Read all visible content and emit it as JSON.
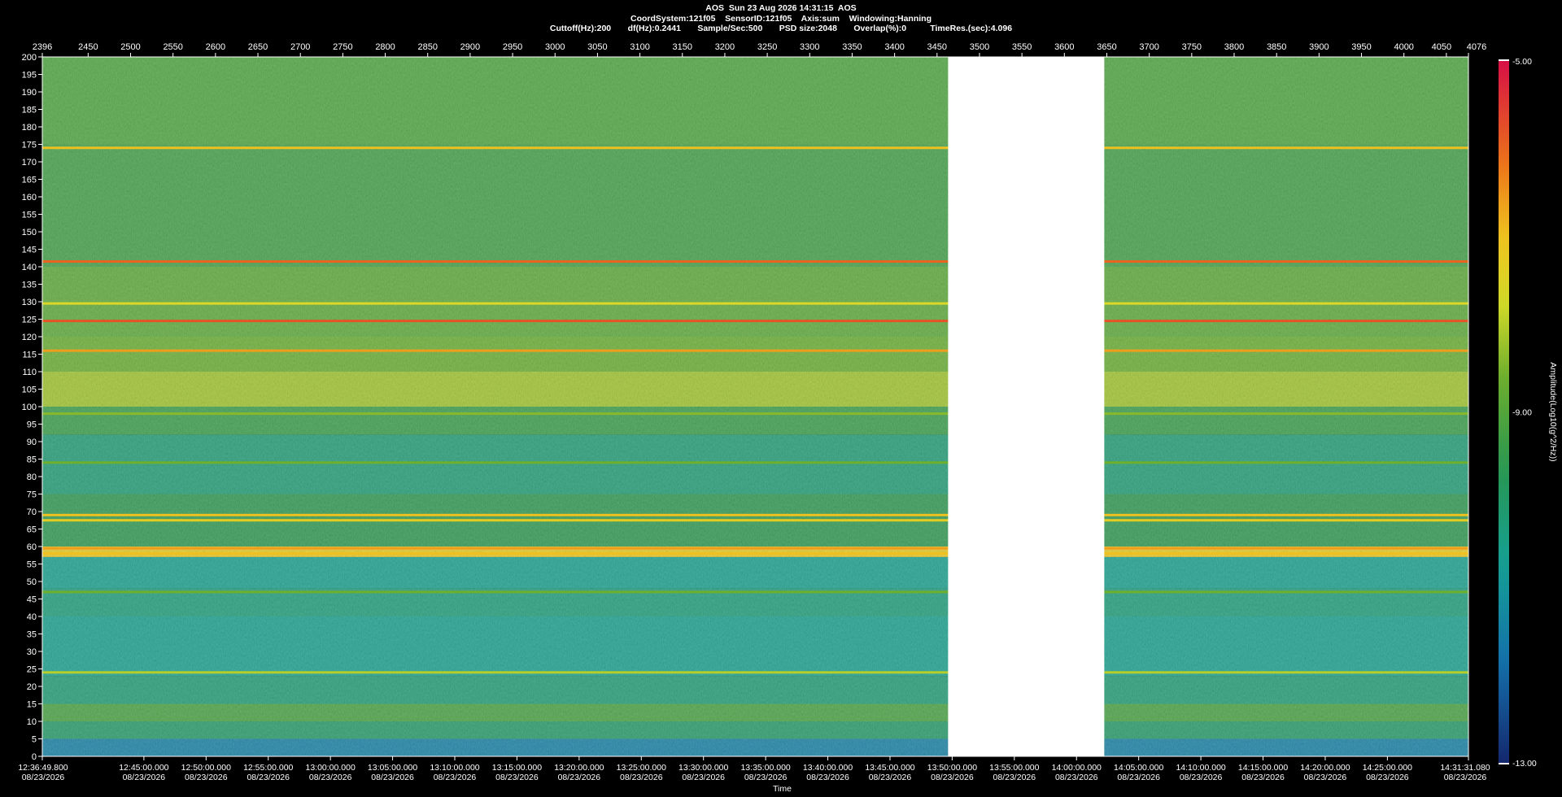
{
  "header": {
    "line1": "AOS  Sun 23 Aug 2026 14:31:15  AOS",
    "line2": "CoordSystem:121f05    SensorID:121f05    Axis:sum    Windowing:Hanning",
    "line3": "Cuttoff(Hz):200       df(Hz):0.2441       Sample/Sec:500       PSD size:2048       Overlap(%):0          TimeRes.(sec):4.096"
  },
  "chart_data": {
    "type": "heatmap",
    "title": "AOS  Sun 23 Aug 2026 14:31:15  AOS",
    "xlabel": "Time",
    "ylabel": "",
    "colorbar_label": "Amplitude(Log10(g^2/Hz))",
    "colorbar_range": [
      -13.0,
      -5.0
    ],
    "colorbar_ticks": [
      "-5.00",
      "-9.00",
      "-13.00"
    ],
    "ylim": [
      0,
      200
    ],
    "y_ticks": [
      200,
      195,
      190,
      185,
      180,
      175,
      170,
      165,
      160,
      155,
      150,
      145,
      140,
      135,
      130,
      125,
      120,
      115,
      110,
      105,
      100,
      95,
      90,
      85,
      80,
      75,
      70,
      65,
      60,
      55,
      50,
      45,
      40,
      35,
      30,
      25,
      20,
      15,
      10,
      5,
      0
    ],
    "top_axis_range": [
      2396,
      4076
    ],
    "top_axis_ticks": [
      2396,
      2450,
      2500,
      2550,
      2600,
      2650,
      2700,
      2750,
      2800,
      2850,
      2900,
      2950,
      3000,
      3050,
      3100,
      3150,
      3200,
      3250,
      3300,
      3350,
      3400,
      3450,
      3500,
      3550,
      3600,
      3650,
      3700,
      3750,
      3800,
      3850,
      3900,
      3950,
      4000,
      4050,
      4076
    ],
    "time_axis": {
      "start": "12:36:49.800",
      "end": "14:31:31.080",
      "ticks": [
        {
          "time": "12:36:49.800",
          "date": "08/23/2026"
        },
        {
          "time": "12:45:00.000",
          "date": "08/23/2026"
        },
        {
          "time": "12:50:00.000",
          "date": "08/23/2026"
        },
        {
          "time": "12:55:00.000",
          "date": "08/23/2026"
        },
        {
          "time": "13:00:00.000",
          "date": "08/23/2026"
        },
        {
          "time": "13:05:00.000",
          "date": "08/23/2026"
        },
        {
          "time": "13:10:00.000",
          "date": "08/23/2026"
        },
        {
          "time": "13:15:00.000",
          "date": "08/23/2026"
        },
        {
          "time": "13:20:00.000",
          "date": "08/23/2026"
        },
        {
          "time": "13:25:00.000",
          "date": "08/23/2026"
        },
        {
          "time": "13:30:00.000",
          "date": "08/23/2026"
        },
        {
          "time": "13:35:00.000",
          "date": "08/23/2026"
        },
        {
          "time": "13:40:00.000",
          "date": "08/23/2026"
        },
        {
          "time": "13:45:00.000",
          "date": "08/23/2026"
        },
        {
          "time": "13:50:00.000",
          "date": "08/23/2026"
        },
        {
          "time": "13:55:00.000",
          "date": "08/23/2026"
        },
        {
          "time": "14:00:00.000",
          "date": "08/23/2026"
        },
        {
          "time": "14:05:00.000",
          "date": "08/23/2026"
        },
        {
          "time": "14:10:00.000",
          "date": "08/23/2026"
        },
        {
          "time": "14:15:00.000",
          "date": "08/23/2026"
        },
        {
          "time": "14:20:00.000",
          "date": "08/23/2026"
        },
        {
          "time": "14:25:00.000",
          "date": "08/23/2026"
        },
        {
          "time": "14:31:31.080",
          "date": "08/23/2026"
        }
      ]
    },
    "data_gap": {
      "from_index": 3463,
      "to_index": 3647
    },
    "frequency_bands": [
      {
        "from": 0,
        "to": 5,
        "level": -11.5
      },
      {
        "from": 5,
        "to": 10,
        "level": -10.0
      },
      {
        "from": 10,
        "to": 15,
        "level": -9.2
      },
      {
        "from": 15,
        "to": 23,
        "level": -10.2
      },
      {
        "from": 23,
        "to": 40,
        "level": -10.6
      },
      {
        "from": 40,
        "to": 48,
        "level": -10.3
      },
      {
        "from": 48,
        "to": 57,
        "level": -10.6
      },
      {
        "from": 57,
        "to": 60,
        "level": -7.2
      },
      {
        "from": 60,
        "to": 75,
        "level": -9.6
      },
      {
        "from": 75,
        "to": 92,
        "level": -10.2
      },
      {
        "from": 92,
        "to": 100,
        "level": -9.4
      },
      {
        "from": 100,
        "to": 110,
        "level": -8.2
      },
      {
        "from": 110,
        "to": 120,
        "level": -8.7
      },
      {
        "from": 120,
        "to": 140,
        "level": -8.9
      },
      {
        "from": 140,
        "to": 175,
        "level": -9.3
      },
      {
        "from": 175,
        "to": 200,
        "level": -9.1
      }
    ],
    "peak_lines": [
      {
        "freq": 174,
        "level": -7.0
      },
      {
        "freq": 141.5,
        "level": -6.0
      },
      {
        "freq": 129.5,
        "level": -7.6
      },
      {
        "freq": 124.5,
        "level": -5.8
      },
      {
        "freq": 116,
        "level": -6.6
      },
      {
        "freq": 98,
        "level": -8.4
      },
      {
        "freq": 84,
        "level": -8.6
      },
      {
        "freq": 69,
        "level": -7.0
      },
      {
        "freq": 67.5,
        "level": -7.3
      },
      {
        "freq": 59.5,
        "level": -6.6
      },
      {
        "freq": 58,
        "level": -7.0
      },
      {
        "freq": 47,
        "level": -8.6
      },
      {
        "freq": 24,
        "level": -8.0
      }
    ]
  }
}
